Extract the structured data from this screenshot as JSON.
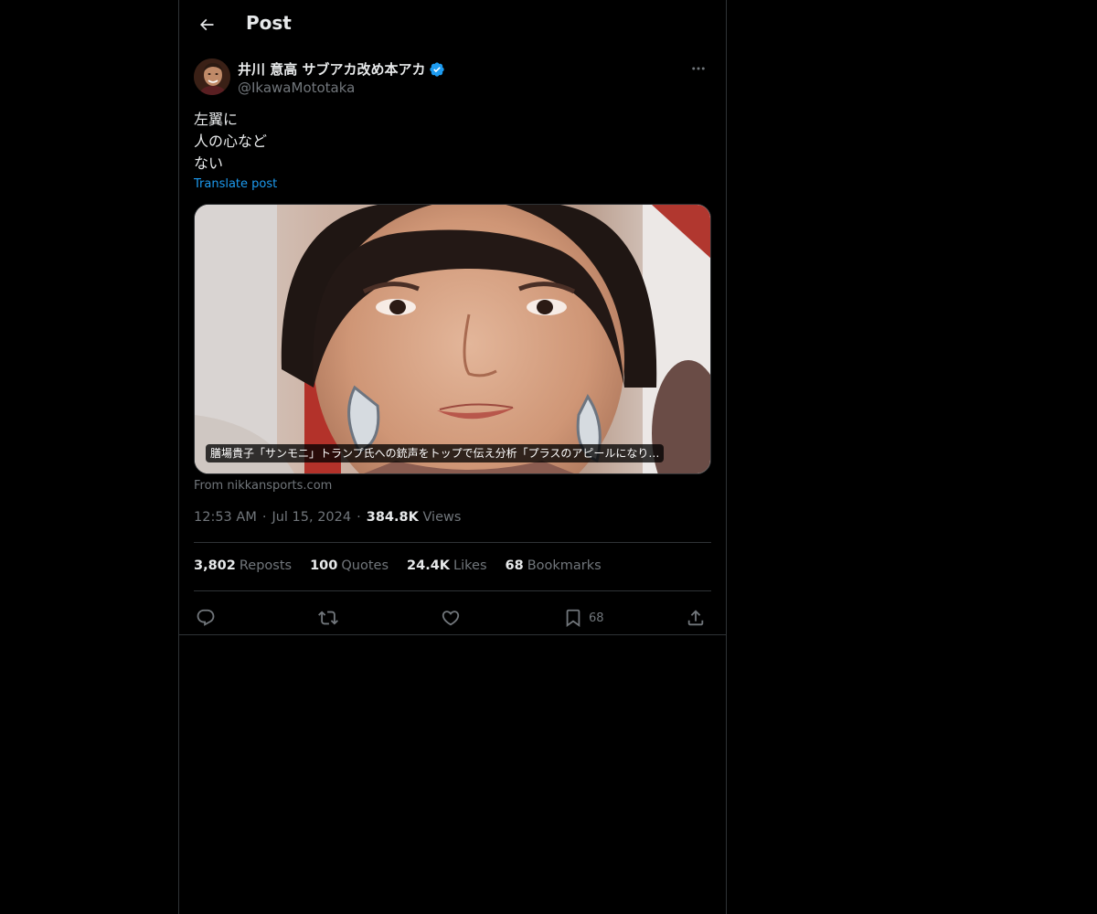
{
  "header": {
    "title": "Post"
  },
  "author": {
    "display_name": "井川 意高 サブアカ改め本アカ",
    "handle": "@IkawaMototaka"
  },
  "post": {
    "lines": [
      "左翼に",
      "人の心など",
      "ない"
    ],
    "translate_label": "Translate post"
  },
  "card": {
    "caption": "膳場貴子「サンモニ」トランプ氏への銃声をトップで伝え分析「プラスのアピールになり…",
    "source": "From nikkansports.com"
  },
  "meta": {
    "time": "12:53 AM",
    "date": "Jul 15, 2024",
    "views_count": "384.8K",
    "views_label": "Views"
  },
  "stats": {
    "reposts": {
      "count": "3,802",
      "label": "Reposts"
    },
    "quotes": {
      "count": "100",
      "label": "Quotes"
    },
    "likes": {
      "count": "24.4K",
      "label": "Likes"
    },
    "bookmarks": {
      "count": "68",
      "label": "Bookmarks"
    }
  },
  "actions": {
    "reply": {
      "icon": "reply-icon"
    },
    "repost": {
      "icon": "repost-icon"
    },
    "like": {
      "icon": "heart-icon"
    },
    "bookmark": {
      "icon": "bookmark-icon",
      "count": "68"
    },
    "share": {
      "icon": "share-icon"
    }
  },
  "colors": {
    "background": "#000000",
    "text": "#e7e9ea",
    "muted": "#71767b",
    "accent": "#1d9bf0",
    "border": "#2f3336"
  }
}
